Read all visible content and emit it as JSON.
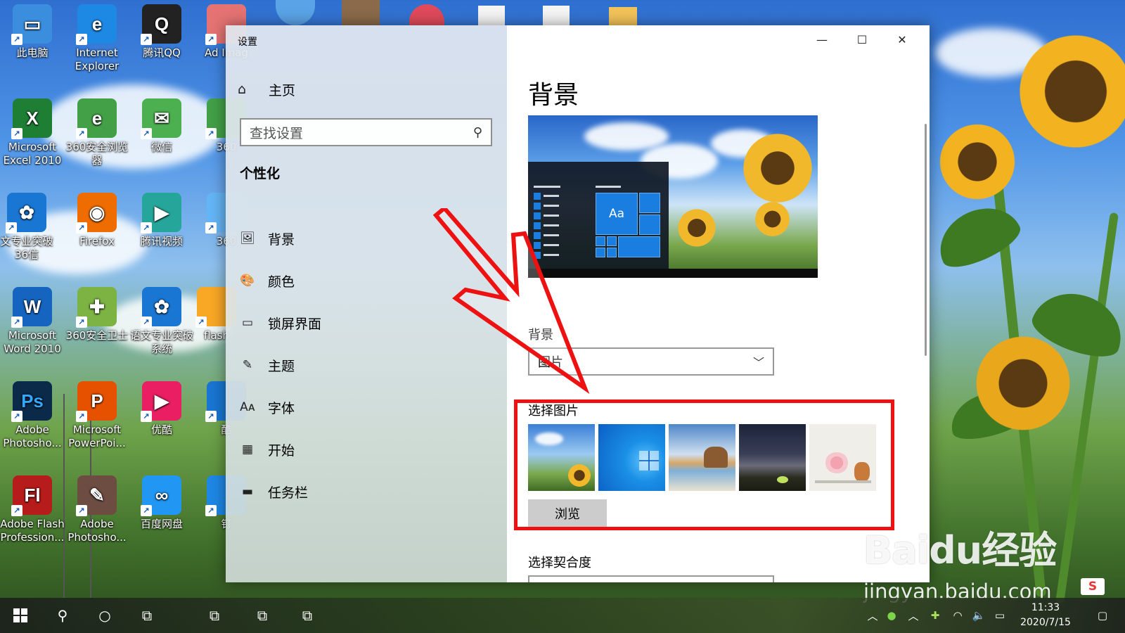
{
  "desktop": {
    "icons": [
      {
        "label": "此电脑",
        "glyph": "▭",
        "color": "#3b8ede"
      },
      {
        "label": "Internet Explorer",
        "glyph": "e",
        "color": "#1e88e5"
      },
      {
        "label": "腾讯QQ",
        "glyph": "Q",
        "color": "#222222"
      },
      {
        "label": "Microsoft Excel 2010",
        "glyph": "X",
        "color": "#1e7e34"
      },
      {
        "label": "360安全浏览器",
        "glyph": "e",
        "color": "#43a047"
      },
      {
        "label": "微信",
        "glyph": "✉",
        "color": "#4caf50"
      },
      {
        "label": "文专业突破 36信",
        "glyph": "✿",
        "color": "#1976d2"
      },
      {
        "label": "Firefox",
        "glyph": "◉",
        "color": "#ef6c00"
      },
      {
        "label": "腾讯视频",
        "glyph": "▶",
        "color": "#26a69a"
      },
      {
        "label": "Microsoft Word 2010",
        "glyph": "W",
        "color": "#1565c0"
      },
      {
        "label": "360安全卫士",
        "glyph": "✚",
        "color": "#7cb342"
      },
      {
        "label": "语文专业突破 系统",
        "glyph": "✿",
        "color": "#1976d2"
      },
      {
        "label": "Adobe Photosho...",
        "glyph": "Ps",
        "color": "#0b2a4a"
      },
      {
        "label": "Microsoft PowerPoi...",
        "glyph": "P",
        "color": "#e65100"
      },
      {
        "label": "优酷",
        "glyph": "▶",
        "color": "#e91e63"
      },
      {
        "label": "Adobe Flash Profession...",
        "glyph": "Fl",
        "color": "#b71c1c"
      },
      {
        "label": "Adobe Photosho...",
        "glyph": "✎",
        "color": "#6d4c41"
      },
      {
        "label": "百度网盘",
        "glyph": "∞",
        "color": "#2196f3"
      }
    ],
    "partial_icons": [
      {
        "label": "Ad Imag",
        "color": "#e57373"
      },
      {
        "label": "360",
        "color": "#43a047"
      },
      {
        "label": "360",
        "color": "#64b5f6"
      },
      {
        "label": "flash",
        "color": "#f9a825"
      },
      {
        "label": "酷",
        "color": "#1976d2"
      },
      {
        "label": "钉",
        "color": "#1e88e5"
      }
    ]
  },
  "window": {
    "title": "设置",
    "minimize_glyph": "—",
    "maximize_glyph": "☐",
    "close_glyph": "✕"
  },
  "sidebar": {
    "home_label": "主页",
    "search_placeholder": "查找设置",
    "section_title": "个性化",
    "items": [
      {
        "label": "背景",
        "icon": "🖼"
      },
      {
        "label": "颜色",
        "icon": "🎨"
      },
      {
        "label": "锁屏界面",
        "icon": "▭"
      },
      {
        "label": "主题",
        "icon": "✎"
      },
      {
        "label": "字体",
        "icon": "Aᴀ"
      },
      {
        "label": "开始",
        "icon": "▦"
      },
      {
        "label": "任务栏",
        "icon": "▬"
      }
    ]
  },
  "main": {
    "page_title": "背景",
    "preview_tile_text": "Aa",
    "background_label": "背景",
    "background_value": "图片",
    "choose_picture_label": "选择图片",
    "browse_label": "浏览",
    "fit_label": "选择契合度"
  },
  "taskbar": {
    "clock_time": "11:33",
    "clock_date": "2020/7/15"
  },
  "watermark": {
    "logo": "Baidu经验",
    "url": "jingyan.baidu.com"
  },
  "colors": {
    "highlight": "#e11111",
    "accent": "#1a7ee0"
  }
}
